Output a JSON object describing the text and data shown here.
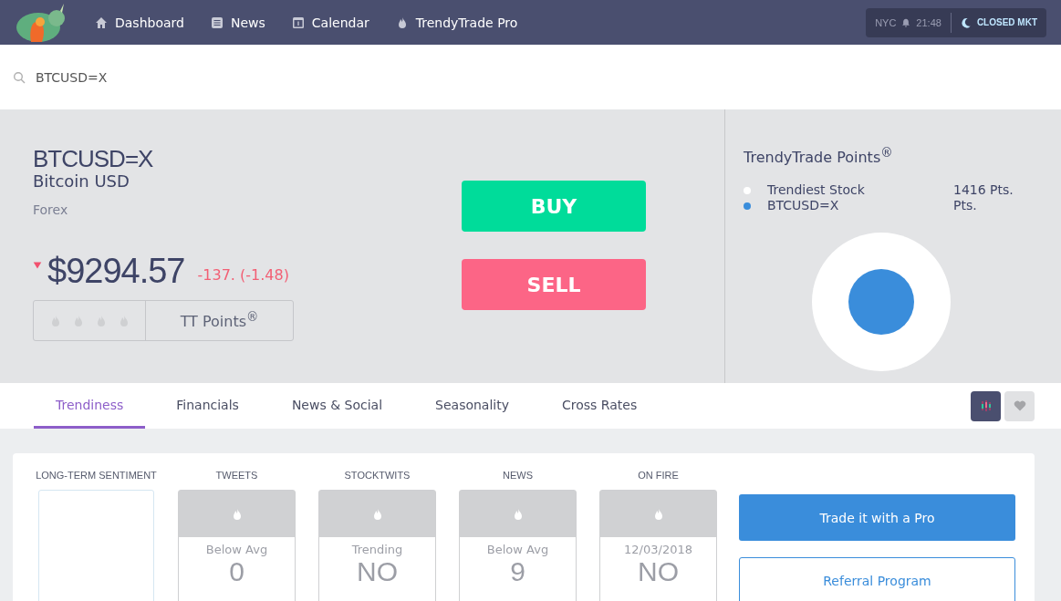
{
  "nav": {
    "items": [
      {
        "kind": "home",
        "label": "Dashboard"
      },
      {
        "kind": "news",
        "label": "News"
      },
      {
        "kind": "calendar",
        "label": "Calendar"
      },
      {
        "kind": "flame",
        "label": "TrendyTrade Pro"
      }
    ],
    "clock": {
      "city": "NYC",
      "time": "21:48",
      "market": "CLOSED MKT"
    }
  },
  "search": {
    "value": "BTCUSD=X"
  },
  "quote": {
    "symbol": "BTCUSD=X",
    "name": "Bitcoin USD",
    "type": "Forex",
    "price_down": true,
    "price": "$9294.57",
    "change": "-137. (-1.48)",
    "points_label": "TT Points$^{®}$"
  },
  "actions": [
    {
      "kind": "buy",
      "label": "BUY"
    },
    {
      "kind": "sell",
      "label": "SELL"
    }
  ],
  "points": {
    "title": "TrendyTrade Points$^{®}$",
    "legend": [
      {
        "label": "Trendiest Stock",
        "value": "1416 Pts.",
        "color": "#ffffff"
      },
      {
        "label": "BTCUSD=X",
        "value": "Pts.",
        "color": "#3a8ddb"
      }
    ]
  },
  "tabs": [
    {
      "label": "Trendiness",
      "selected": true
    },
    {
      "label": "Financials",
      "selected": false
    },
    {
      "label": "News & Social",
      "selected": false
    },
    {
      "label": "Seasonality",
      "selected": false
    },
    {
      "label": "Cross Rates",
      "selected": false
    }
  ],
  "view_buttons": [
    {
      "kind": "chart",
      "selected": true
    },
    {
      "kind": "favorite",
      "selected": false
    }
  ],
  "sentiment": {
    "label": "LONG-TERM SENTIMENT"
  },
  "metrics": [
    {
      "label": "TWEETS",
      "status": "Below Avg",
      "value": "0"
    },
    {
      "label": "STOCKTWITS",
      "status": "Trending",
      "value": "NO"
    },
    {
      "label": "NEWS",
      "status": "Below Avg",
      "value": "9"
    },
    {
      "label": "ON FIRE",
      "status": "12/03/2018",
      "value": "NO"
    }
  ],
  "links": [
    {
      "kind": "primary",
      "label": "Trade it with a Pro"
    },
    {
      "kind": "outline",
      "label": "Referral Program"
    }
  ]
}
